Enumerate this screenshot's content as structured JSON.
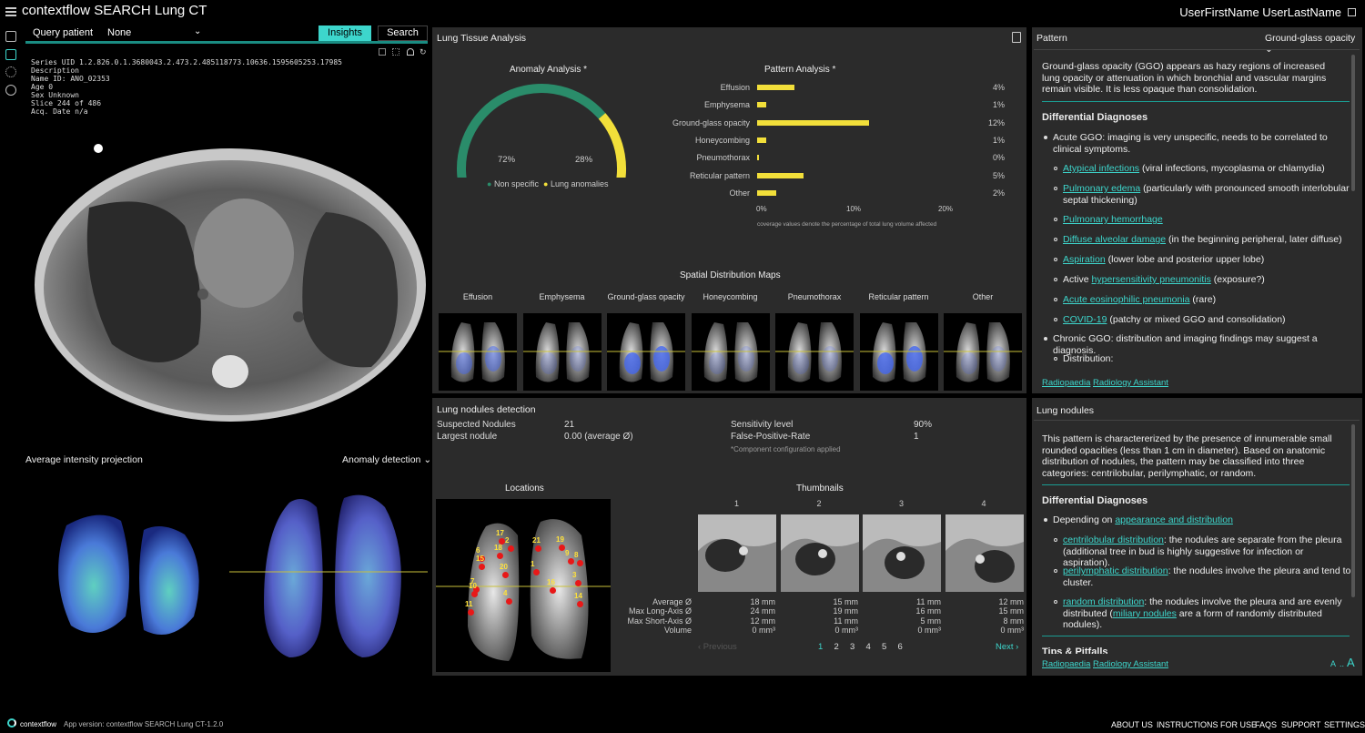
{
  "app": {
    "title": "contextflow SEARCH Lung CT",
    "user": "UserFirstName UserLastName",
    "version": "App version: contextflow SEARCH Lung CT-1.2.0",
    "logo_text": "contextflow"
  },
  "query": {
    "label": "Query patient",
    "value": "None",
    "insights": "Insights",
    "search": "Search"
  },
  "series": {
    "uid": "Series UID 1.2.826.0.1.3680043.2.473.2.485118773.10636.1595605253.17985",
    "description": "Description",
    "name_id": "Name ID: ANO_02353",
    "age": "Age 0",
    "sex": "Sex Unknown",
    "slice": "Slice 244 of 486",
    "acq_date": "Acq. Date n/a"
  },
  "aip": {
    "title": "Average intensity projection",
    "dropdown": "Anomaly detection"
  },
  "lung_tissue": {
    "title": "Lung Tissue Analysis",
    "anomaly": {
      "title": "Anomaly Analysis *",
      "nonspecific_pct": "72%",
      "anomaly_pct": "28%",
      "nonspecific_fraction": 0.72,
      "legend_nonspecific": "Non specific",
      "legend_anomalies": "Lung anomalies",
      "color_nonspecific": "#2a8c6a",
      "color_anomalies": "#f2df3a"
    },
    "pattern_title": "Pattern Analysis *",
    "patterns": [
      {
        "name": "Effusion",
        "pct": "4%",
        "value": 4
      },
      {
        "name": "Emphysema",
        "pct": "1%",
        "value": 1
      },
      {
        "name": "Ground-glass opacity",
        "pct": "12%",
        "value": 12
      },
      {
        "name": "Honeycombing",
        "pct": "1%",
        "value": 1
      },
      {
        "name": "Pneumothorax",
        "pct": "0%",
        "value": 0.2
      },
      {
        "name": "Reticular pattern",
        "pct": "5%",
        "value": 5
      },
      {
        "name": "Other",
        "pct": "2%",
        "value": 2
      }
    ],
    "axis_ticks": [
      "0%",
      "10%",
      "20%"
    ],
    "axis_note": "coverage values denote the percentage of total lung volume affected",
    "spatial_title": "Spatial Distribution Maps",
    "maps": [
      "Effusion",
      "Emphysema",
      "Ground-glass opacity",
      "Honeycombing",
      "Pneumothorax",
      "Reticular pattern",
      "Other"
    ]
  },
  "nodules": {
    "title": "Lung nodules detection",
    "suspected_label": "Suspected Nodules",
    "suspected_value": "21",
    "largest_label": "Largest nodule",
    "largest_value": "0.00 (average Ø)",
    "sensitivity_label": "Sensitivity level",
    "sensitivity_value": "90%",
    "fpr_label": "False-Positive-Rate",
    "fpr_value": "1",
    "config_note": "*Component configuration applied",
    "locations_title": "Locations",
    "thumbnails_title": "Thumbnails",
    "thumb_nums": [
      "1",
      "2",
      "3",
      "4"
    ],
    "metrics": [
      {
        "label": "Average Ø",
        "values": [
          "18 mm",
          "15 mm",
          "11 mm",
          "12 mm"
        ]
      },
      {
        "label": "Max Long-Axis Ø",
        "values": [
          "24 mm",
          "19 mm",
          "16 mm",
          "15 mm"
        ]
      },
      {
        "label": "Max Short-Axis Ø",
        "values": [
          "12 mm",
          "11 mm",
          "5 mm",
          "8 mm"
        ]
      },
      {
        "label": "Volume",
        "values": [
          "0 mm³",
          "0 mm³",
          "0 mm³",
          "0 mm³"
        ]
      }
    ],
    "prev": "‹ Previous",
    "next": "Next ›",
    "pages": [
      "1",
      "2",
      "3",
      "4",
      "5",
      "6"
    ],
    "markers": [
      "17",
      "2",
      "21",
      "19",
      "6",
      "18",
      "15",
      "8",
      "9",
      "20",
      "3",
      "7",
      "10",
      "16",
      "11",
      "14",
      "4",
      "1"
    ]
  },
  "pattern_panel": {
    "title": "Pattern",
    "selected": "Ground-glass opacity",
    "intro": "Ground-glass opacity (GGO) appears as hazy regions of increased lung opacity or attenuation in which bronchial and vascular margins remain visible. It is less opaque than consolidation.",
    "dd_heading": "Differential Diagnoses",
    "acute": "Acute GGO: imaging is very unspecific, needs to be correlated to clinical symptoms.",
    "items": [
      {
        "link": "Atypical infections",
        "rest": " (viral infections, mycoplasma or chlamydia)"
      },
      {
        "link": "Pulmonary edema",
        "rest": " (particularly with pronounced smooth interlobular septal thickening)"
      },
      {
        "link": "Pulmonary hemorrhage",
        "rest": ""
      },
      {
        "link": "Diffuse alveolar damage",
        "rest": " (in the beginning peripheral, later diffuse)"
      },
      {
        "link": "Aspiration",
        "rest": " (lower lobe and posterior upper lobe)"
      },
      {
        "pre": "Active ",
        "link": "hypersensitivity pneumonitis",
        "rest": " (exposure?)"
      },
      {
        "link": "Acute eosinophilic pneumonia",
        "rest": " (rare)"
      },
      {
        "link": "COVID-19",
        "rest": " (patchy or mixed GGO and consolidation)"
      }
    ],
    "chronic": "Chronic GGO: distribution and imaging findings may suggest a diagnosis.",
    "distribution": "Distribution:",
    "ref1": "Radiopaedia",
    "ref2": "Radiology Assistant"
  },
  "nodule_panel": {
    "title": "Lung nodules",
    "intro": "This pattern is charactererized by the presence of innumerable small rounded opacities (less than 1 cm in diameter). Based on anatomic distribution of nodules, the pattern may be classified into three categories: centrilobular, perilymphatic, or random.",
    "dd_heading": "Differential Diagnoses",
    "depending": "Depending on ",
    "depending_link": "appearance and distribution",
    "c1_link": "centrilobular distribution",
    "c1_rest": ": the nodules are separate from the pleura (additional tree in bud is highly suggestive for infection or aspiration).",
    "c2_link": "perilymphatic distribution",
    "c2_rest": ": the nodules involve the pleura and tend to cluster.",
    "c3_link": "random distribution",
    "c3_pre": ": the nodules involve the pleura and are evenly distributed (",
    "c3_link2": "miliary nodules",
    "c3_rest": " are a form of randomly distributed nodules).",
    "tips": "Tips & Pitfalls",
    "ref1": "Radiopaedia",
    "ref2": "Radiology Assistant",
    "font_small": "A",
    "font_sep": "..",
    "font_large": "A"
  },
  "footer": {
    "about": "ABOUT US",
    "ifu": "INSTRUCTIONS FOR USE",
    "faqs": "FAQS",
    "support": "SUPPORT",
    "settings": "SETTINGS"
  }
}
